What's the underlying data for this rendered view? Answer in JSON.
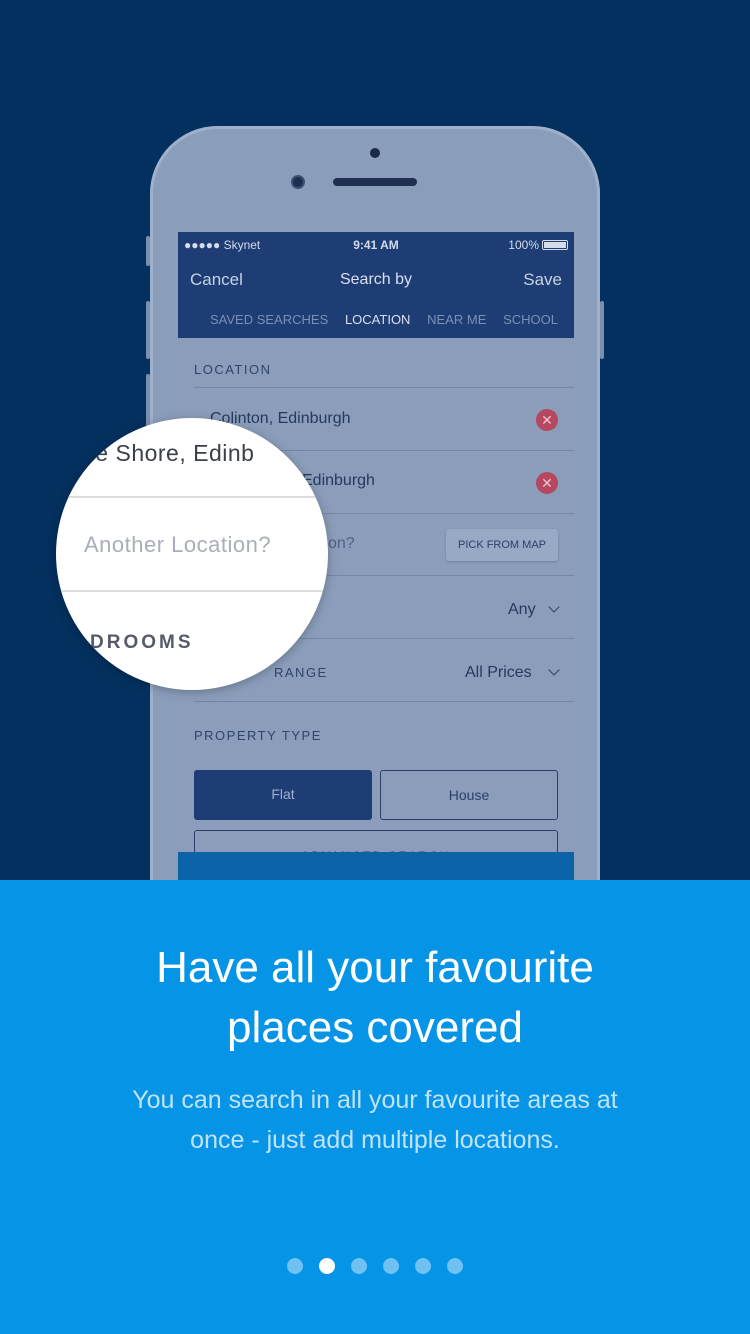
{
  "phone": {
    "status": {
      "carrier": "●●●●● Skynet",
      "time": "9:41 AM",
      "battery": "100%"
    },
    "nav": {
      "cancel": "Cancel",
      "title": "Search by",
      "save": "Save"
    },
    "tabs": [
      "SAVED SEARCHES",
      "LOCATION",
      "NEAR ME",
      "SCHOOL"
    ],
    "active_tab": "LOCATION",
    "location_label": "LOCATION",
    "locations": [
      "Colinton, Edinburgh",
      "Edinburgh"
    ],
    "another_location_partial": "on?",
    "pick_from_map": "PICK FROM MAP",
    "bedrooms_value": "Any",
    "price_label_partial": "RANGE",
    "price_value": "All Prices",
    "property_type_label": "PROPERTY TYPE",
    "property_types": [
      "Flat",
      "House"
    ],
    "advanced_search": "ADVANCED SEARCH"
  },
  "magnifier": {
    "location_text": "he Shore, Edinb",
    "placeholder": "Another Location?",
    "bedrooms_partial": "DROOMS"
  },
  "onboarding": {
    "headline_line1": "Have all your favourite",
    "headline_line2": "places covered",
    "body_line1": "You can search in all your favourite areas at",
    "body_line2": "once - just add multiple locations.",
    "page_count": 6,
    "active_page": 2
  },
  "colors": {
    "background": "#04305f",
    "panel": "#0694e6",
    "remove": "#b5475e"
  }
}
